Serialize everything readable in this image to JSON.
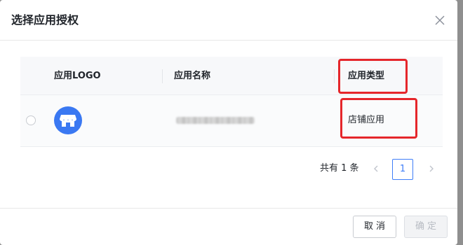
{
  "dialog": {
    "title": "选择应用授权"
  },
  "table": {
    "columns": [
      "应用LOGO",
      "应用名称",
      "应用类型"
    ],
    "rows": [
      {
        "logo_icon": "store-icon",
        "name": "",
        "type": "店铺应用"
      }
    ]
  },
  "pagination": {
    "total_text": "共有 1 条",
    "current_page": "1"
  },
  "footer": {
    "cancel_label": "取消",
    "ok_label": "确定"
  },
  "colors": {
    "accent": "#3f7ef8",
    "highlight_box": "#e5262b",
    "logo_bg": "#3a78f2"
  }
}
